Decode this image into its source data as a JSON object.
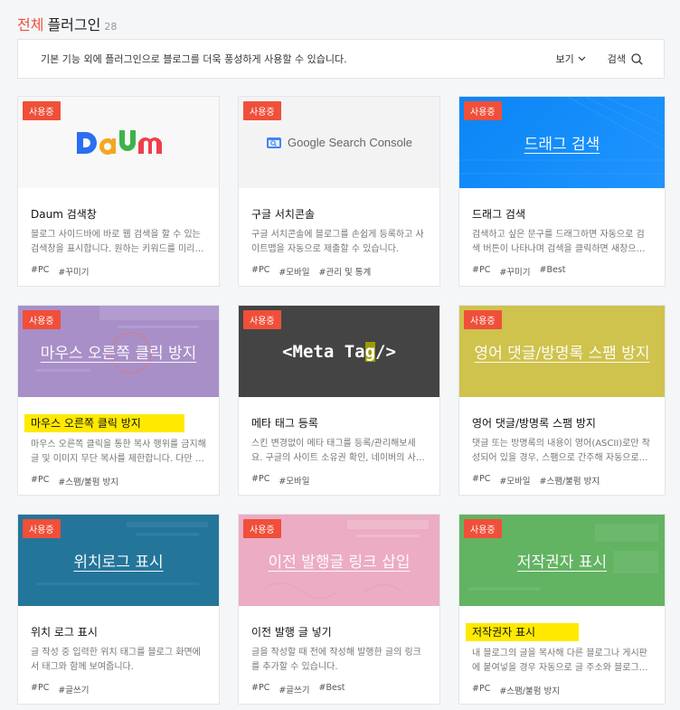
{
  "header": {
    "title_accent": "전체",
    "title_rest": "플러그인",
    "count": "28"
  },
  "toolbar": {
    "description": "기본 기능 외에 플러그인으로 블로그를 더욱 풍성하게 사용할 수 있습니다.",
    "view_label": "보기",
    "search_label": "검색"
  },
  "badge_text": "사용중",
  "cards": [
    {
      "thumb": "Daum",
      "name": "Daum 검색창",
      "desc": "블로그 사이드바에 바로 웹 검색을 할 수 있는 검색창을 표시합니다. 원하는 키워드를 미리 …",
      "tags": [
        "#PC",
        "#꾸미기"
      ]
    },
    {
      "thumb": "Google Search Console",
      "name": "구글 서치콘솔",
      "desc": "구글 서치콘솔에 블로그를 손쉽게 등록하고 사이트맵을 자동으로 제출할 수 있습니다.",
      "tags": [
        "#PC",
        "#모바일",
        "#관리 및 통계"
      ]
    },
    {
      "thumb": "드래그 검색",
      "name": "드래그 검색",
      "desc": "검색하고 싶은 문구를 드래그하면 자동으로 검색 버튼이 나타나며 검색을 클릭하면 새창으…",
      "tags": [
        "#PC",
        "#꾸미기",
        "#Best"
      ]
    },
    {
      "thumb": "마우스 오른쪽 클릭 방지",
      "name": "마우스 오른쪽 클릭 방지",
      "desc": "마우스 오른쪽 클릭을 통한 복사 행위를 금지해 글 및 이미지 무단 복사를 제한합니다. 다만 …",
      "tags": [
        "#PC",
        "#스팸/불펌 방지"
      ]
    },
    {
      "thumb_pre": "<Meta Ta",
      "thumb_cur": "g",
      "thumb_post": "/>",
      "name": "메타 태그 등록",
      "desc": "스킨 변경없이 메타 태그를 등록/관리해보세요. 구글의 사이트 소유권 확인, 네이버의 사…",
      "tags": [
        "#PC",
        "#모바일"
      ]
    },
    {
      "thumb": "영어 댓글/방명록 스팸 방지",
      "name": "영어 댓글/방명록 스팸 방지",
      "desc": "댓글 또는 방명록의 내용이 영어(ASCII)로만 작성되어 있을 경우, 스팸으로 간주해 자동으로…",
      "tags": [
        "#PC",
        "#모바일",
        "#스팸/불펌 방지"
      ]
    },
    {
      "thumb": "위치로그 표시",
      "name": "위치 로그 표시",
      "desc": "글 작성 중 입력한 위치 태그를 블로그 화면에서 태그와 함께 보여줍니다.",
      "tags": [
        "#PC",
        "#글쓰기"
      ]
    },
    {
      "thumb": "이전 발행글 링크 삽입",
      "name": "이전 발행 글 넣기",
      "desc": "글을 작성할 때 전에 작성해 발행한 글의 링크를 추가할 수 있습니다.",
      "tags": [
        "#PC",
        "#글쓰기",
        "#Best"
      ]
    },
    {
      "thumb": "저작권자 표시",
      "name": "저작권자 표시",
      "desc": "내 블로그의 글을 복사해 다른 블로그나 게시판에 붙여넣을 경우 자동으로 글 주소와 블로그…",
      "tags": [
        "#PC",
        "#스팸/불펌 방지"
      ]
    }
  ],
  "colors": {
    "accent": "#f04f3a",
    "highlight": "#ffe900"
  }
}
